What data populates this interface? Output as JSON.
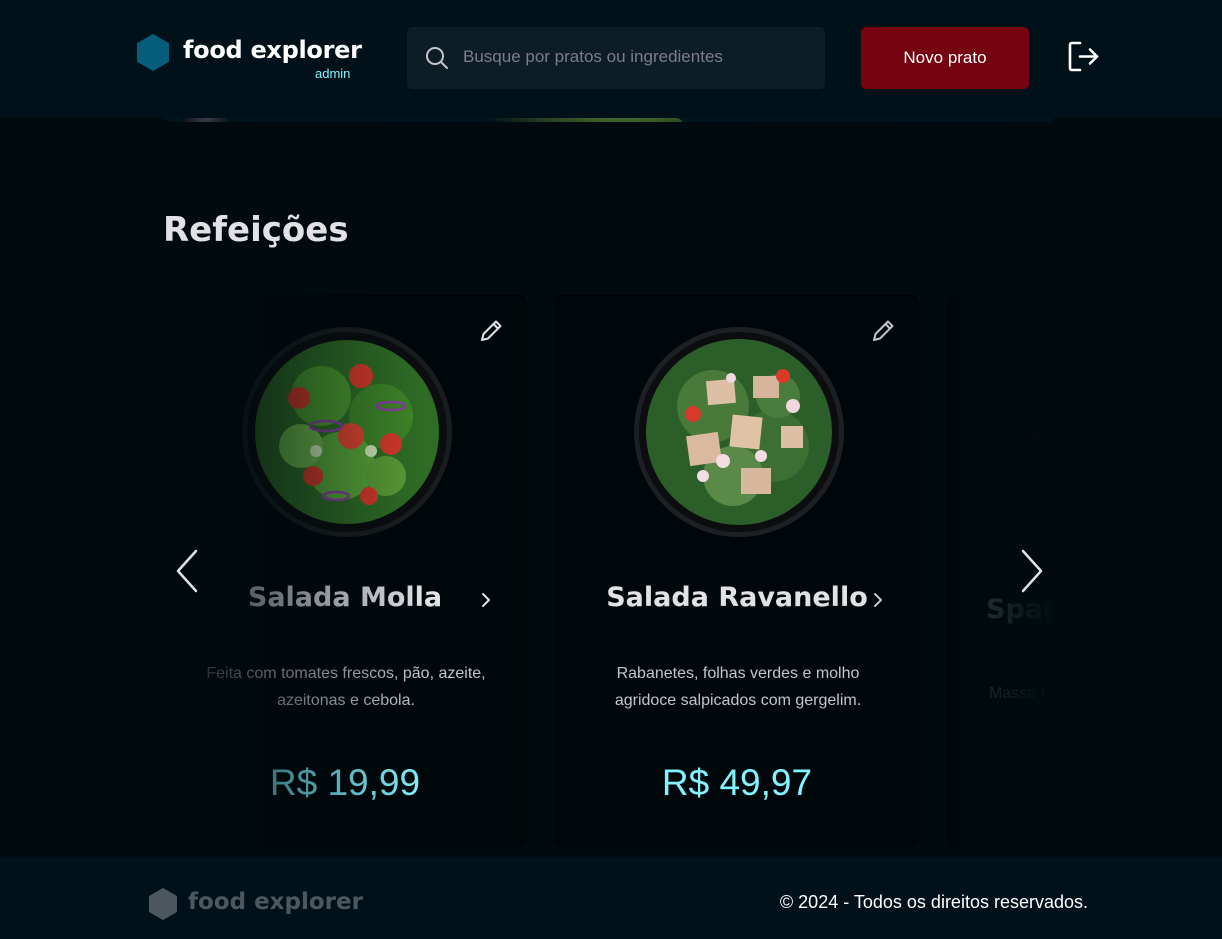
{
  "header": {
    "brand_name": "food explorer",
    "brand_role": "admin",
    "search_placeholder": "Busque por pratos ou ingredientes",
    "new_dish_label": "Novo prato",
    "colors": {
      "background": "#00111a",
      "brand_hex": "#065e7c",
      "accent_text": "#82f3ff",
      "button": "#750310"
    },
    "icons": [
      "hexagon-logo-icon",
      "search-icon",
      "sign-out-icon"
    ]
  },
  "section": {
    "title": "Refeições",
    "cards": [
      {
        "name": "Salada Molla",
        "description": "Feita com tomates frescos, pão, azeite, azeitonas e cebola.",
        "price": "R$ 19,99",
        "icon": "pencil-icon"
      },
      {
        "name": "Salada Ravanello",
        "description": "Rabanetes, folhas verdes e molho agridoce salpicados com gergelim.",
        "price": "R$ 49,97",
        "icon": "pencil-icon"
      },
      {
        "name": "Spag",
        "description": "Massa f"
      }
    ],
    "carousel_icons": [
      "chevron-left-icon",
      "chevron-right-icon"
    ]
  },
  "footer": {
    "brand_name": "food explorer",
    "copyright": "© 2024 - Todos os direitos reservados."
  }
}
